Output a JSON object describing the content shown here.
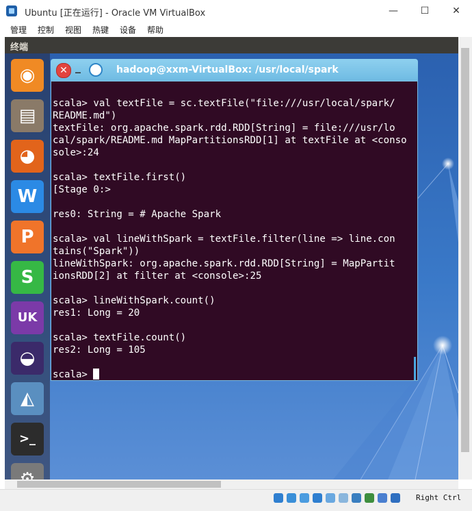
{
  "window": {
    "title": "Ubuntu [正在运行] - Oracle VM VirtualBox",
    "min_glyph": "—",
    "max_glyph": "☐",
    "close_glyph": "✕"
  },
  "menubar": [
    "管理",
    "控制",
    "视图",
    "热键",
    "设备",
    "帮助"
  ],
  "vm": {
    "topbar_title": "终端"
  },
  "launcher": [
    {
      "name": "ubuntu-dash-icon",
      "color": "#f08a24",
      "glyph": "◉"
    },
    {
      "name": "files-cabinet-icon",
      "color": "#8a7a68",
      "glyph": "▤"
    },
    {
      "name": "firefox-icon",
      "color": "#e2641b",
      "glyph": "◕"
    },
    {
      "name": "wps-writer-icon",
      "color": "#2b8ae5",
      "glyph": "W"
    },
    {
      "name": "wps-presentation-icon",
      "color": "#f0742a",
      "glyph": "P"
    },
    {
      "name": "wps-spreadsheets-icon",
      "color": "#36b845",
      "glyph": "S"
    },
    {
      "name": "ubuntu-one-uk-icon",
      "color": "#7b3aa8",
      "glyph": "UK"
    },
    {
      "name": "eclipse-icon",
      "color": "#3b2a6a",
      "glyph": "◒"
    },
    {
      "name": "software-updater-icon",
      "color": "#5a8fc0",
      "glyph": "◭"
    },
    {
      "name": "terminal-icon",
      "color": "#2c2c2c",
      "glyph": ">_"
    },
    {
      "name": "system-settings-gear-icon",
      "color": "#7a7a7a",
      "glyph": "⚙"
    }
  ],
  "terminal": {
    "title": "hadoop@xxm-VirtualBox: /usr/local/spark",
    "min_glyph": "_",
    "close_glyph": "✕",
    "lines": [
      "",
      "scala> val textFile = sc.textFile(\"file:///usr/local/spark/",
      "README.md\")",
      "textFile: org.apache.spark.rdd.RDD[String] = file:///usr/lo",
      "cal/spark/README.md MapPartitionsRDD[1] at textFile at <conso",
      "sole>:24",
      "",
      "scala> textFile.first()",
      "[Stage 0:>",
      "",
      "res0: String = # Apache Spark",
      "",
      "scala> val lineWithSpark = textFile.filter(line => line.con",
      "tains(\"Spark\"))",
      "lineWithSpark: org.apache.spark.rdd.RDD[String] = MapPartit",
      "ionsRDD[2] at filter at <console>:25",
      "",
      "scala> lineWithSpark.count()",
      "res1: Long = 20",
      "",
      "scala> textFile.count()",
      "res2: Long = 105",
      ""
    ],
    "prompt": "scala> "
  },
  "statusbar": {
    "host_key": "Right Ctrl",
    "icons": [
      "hdd-icon",
      "optical-disc-icon",
      "usb-icon",
      "network-icon",
      "shared-folder-icon",
      "display-icon",
      "video-capture-icon",
      "recording-icon",
      "mouse-integration-icon",
      "keyboard-arrow-icon"
    ]
  }
}
